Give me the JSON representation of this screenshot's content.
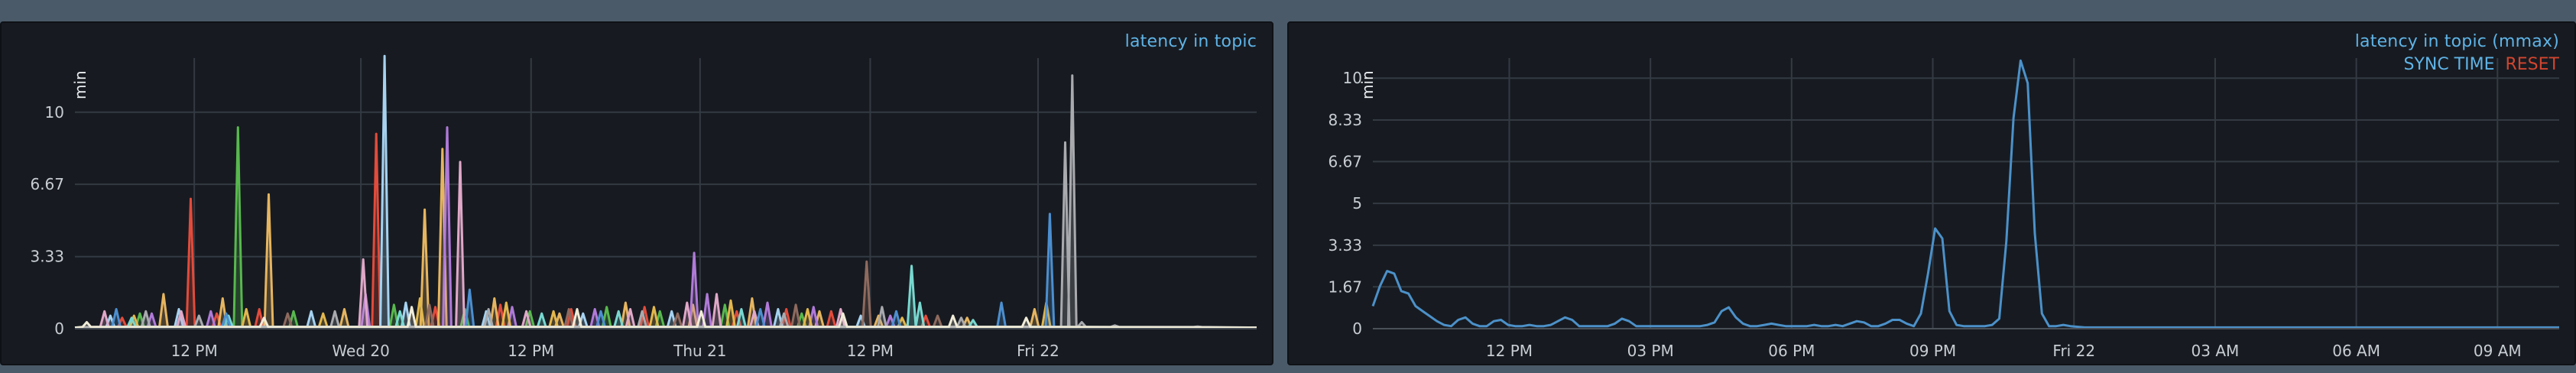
{
  "panels": [
    {
      "title": "latency in topic",
      "unit": "min",
      "sync_label": "",
      "reset_label": ""
    },
    {
      "title": "latency in topic (mmax)",
      "unit": "min",
      "sync_label": "SYNC TIME",
      "reset_label": "RESET"
    }
  ],
  "colors": {
    "page_bg": "#4b5a68",
    "panel_bg": "#171b21",
    "grid": "#343a42",
    "title": "#5fb3e6",
    "reset": "#d2452f",
    "line": "#4c91c9"
  },
  "chart_data": [
    {
      "type": "line",
      "title": "latency in topic",
      "ylabel": "min",
      "xlabel": "",
      "ylim": [
        0,
        12.5
      ],
      "xlim": [
        0,
        100
      ],
      "x_ticks": [
        {
          "x": 10.1,
          "label": "12 PM"
        },
        {
          "x": 24.2,
          "label": "Wed 20"
        },
        {
          "x": 38.6,
          "label": "12 PM"
        },
        {
          "x": 52.9,
          "label": "Thu 21"
        },
        {
          "x": 67.3,
          "label": "12 PM"
        },
        {
          "x": 81.5,
          "label": "Fri 22"
        }
      ],
      "y_ticks": [
        0,
        3.33,
        6.67,
        10
      ],
      "grid": true,
      "legend": "none",
      "series": [
        {
          "color": "#e24b3b",
          "peaks": [
            [
              4,
              0.5
            ],
            [
              9.8,
              6
            ],
            [
              12,
              0.7
            ],
            [
              15.6,
              0.9
            ],
            [
              25.5,
              9
            ],
            [
              30.5,
              1.0
            ],
            [
              36,
              1.1
            ],
            [
              42,
              0.9
            ],
            [
              48.2,
              1.0
            ],
            [
              56,
              0.8
            ],
            [
              60.2,
              0.9
            ],
            [
              64,
              0.8
            ],
            [
              72,
              0.6
            ]
          ]
        },
        {
          "color": "#e6b560",
          "peaks": [
            [
              7.5,
              1.6
            ],
            [
              12.5,
              1.4
            ],
            [
              16.4,
              6.2
            ],
            [
              22.8,
              0.9
            ],
            [
              29.6,
              5.5
            ],
            [
              31.1,
              8.3
            ],
            [
              35.5,
              1.4
            ],
            [
              41,
              0.7
            ],
            [
              46.6,
              1.2
            ],
            [
              52.3,
              1.1
            ],
            [
              57.3,
              1.4
            ],
            [
              63,
              0.8
            ],
            [
              68,
              0.6
            ],
            [
              75.5,
              0.5
            ],
            [
              81.2,
              0.9
            ]
          ]
        },
        {
          "color": "#58b84e",
          "peaks": [
            [
              5.5,
              0.7
            ],
            [
              13.8,
              9.3
            ],
            [
              18.5,
              0.8
            ],
            [
              27,
              1.1
            ],
            [
              33,
              0.9
            ],
            [
              38.5,
              0.8
            ],
            [
              45,
              1.0
            ],
            [
              49.5,
              0.8
            ],
            [
              55,
              1.1
            ],
            [
              61.5,
              0.7
            ]
          ]
        },
        {
          "color": "#a6d2f0",
          "peaks": [
            [
              3,
              0.6
            ],
            [
              8.8,
              0.9
            ],
            [
              20,
              0.8
            ],
            [
              26.2,
              12.6
            ],
            [
              28,
              1.2
            ],
            [
              34.8,
              0.8
            ],
            [
              43,
              0.7
            ],
            [
              50.5,
              0.8
            ],
            [
              59.5,
              0.9
            ],
            [
              66.5,
              0.6
            ]
          ]
        },
        {
          "color": "#b07ad8",
          "peaks": [
            [
              6.5,
              0.7
            ],
            [
              11.5,
              0.8
            ],
            [
              24.6,
              1.6
            ],
            [
              31.5,
              9.3
            ],
            [
              37,
              1.0
            ],
            [
              44,
              0.9
            ],
            [
              52.4,
              3.5
            ],
            [
              53.5,
              1.6
            ],
            [
              58.6,
              1.2
            ],
            [
              62.5,
              1.0
            ],
            [
              69,
              0.6
            ]
          ]
        },
        {
          "color": "#e0a8c8",
          "peaks": [
            [
              2.5,
              0.8
            ],
            [
              9,
              0.8
            ],
            [
              24.4,
              3.2
            ],
            [
              32.6,
              7.7
            ],
            [
              38.2,
              0.8
            ],
            [
              47,
              0.9
            ],
            [
              51.8,
              1.2
            ],
            [
              54.3,
              1.6
            ],
            [
              57.5,
              0.8
            ],
            [
              64.8,
              0.9
            ]
          ]
        },
        {
          "color": "#e2b74d",
          "peaks": [
            [
              5,
              0.6
            ],
            [
              14.5,
              0.9
            ],
            [
              21,
              0.7
            ],
            [
              29.2,
              1.4
            ],
            [
              36.5,
              1.2
            ],
            [
              40.5,
              0.8
            ],
            [
              49,
              1.0
            ],
            [
              55.5,
              1.3
            ],
            [
              62,
              0.9
            ],
            [
              70,
              0.5
            ],
            [
              82.2,
              1.2
            ]
          ]
        },
        {
          "color": "#78d8d0",
          "peaks": [
            [
              4.8,
              0.5
            ],
            [
              13,
              0.6
            ],
            [
              27.5,
              0.8
            ],
            [
              39.5,
              0.7
            ],
            [
              46,
              0.8
            ],
            [
              56.4,
              0.9
            ],
            [
              70.8,
              2.9
            ],
            [
              71.5,
              1.2
            ],
            [
              76,
              0.4
            ]
          ]
        },
        {
          "color": "#8e6a5e",
          "peaks": [
            [
              18,
              0.7
            ],
            [
              30,
              1.1
            ],
            [
              41.8,
              0.9
            ],
            [
              51,
              0.7
            ],
            [
              61,
              1.1
            ],
            [
              67,
              3.1
            ],
            [
              73,
              0.6
            ]
          ]
        },
        {
          "color": "#4c8fd0",
          "peaks": [
            [
              3.5,
              0.9
            ],
            [
              12.8,
              0.7
            ],
            [
              33.4,
              1.8
            ],
            [
              44.5,
              0.8
            ],
            [
              58,
              0.9
            ],
            [
              69.5,
              0.8
            ],
            [
              78.4,
              1.2
            ],
            [
              82.5,
              5.3
            ]
          ]
        },
        {
          "color": "#a8aaae",
          "peaks": [
            [
              6,
              0.8
            ],
            [
              10.5,
              0.6
            ],
            [
              22,
              0.8
            ],
            [
              35,
              0.9
            ],
            [
              48,
              0.8
            ],
            [
              60,
              0.7
            ],
            [
              68.3,
              1.0
            ],
            [
              75,
              0.5
            ],
            [
              83.8,
              8.6
            ],
            [
              84.4,
              11.7
            ],
            [
              85.2,
              0.3
            ],
            [
              88,
              0.15
            ],
            [
              95,
              0.1
            ]
          ]
        },
        {
          "color": "#f0ecd8",
          "peaks": [
            [
              1,
              0.3
            ],
            [
              16,
              0.5
            ],
            [
              28.5,
              1.0
            ],
            [
              42.5,
              0.9
            ],
            [
              53,
              0.8
            ],
            [
              65,
              0.7
            ],
            [
              74.3,
              0.6
            ],
            [
              80.5,
              0.5
            ]
          ]
        }
      ]
    },
    {
      "type": "line",
      "title": "latency in topic (mmax)",
      "ylabel": "min",
      "xlabel": "",
      "ylim": [
        0,
        10.8
      ],
      "xlim": [
        0,
        100
      ],
      "x_ticks": [
        {
          "x": 11.5,
          "label": "12 PM"
        },
        {
          "x": 23.4,
          "label": "03 PM"
        },
        {
          "x": 35.3,
          "label": "06 PM"
        },
        {
          "x": 47.2,
          "label": "09 PM"
        },
        {
          "x": 59.1,
          "label": "Fri 22"
        },
        {
          "x": 71.0,
          "label": "03 AM"
        },
        {
          "x": 82.9,
          "label": "06 AM"
        },
        {
          "x": 94.8,
          "label": "09 AM"
        }
      ],
      "y_ticks": [
        0,
        1.67,
        3.33,
        5,
        6.67,
        8.33,
        10
      ],
      "grid": true,
      "legend": "none",
      "series": [
        {
          "color": "#4c91c9",
          "x": [
            0,
            0.6,
            1.2,
            1.8,
            2.4,
            3.0,
            3.6,
            4.2,
            4.8,
            5.4,
            6.0,
            6.6,
            7.2,
            7.8,
            8.4,
            9.0,
            9.6,
            10.2,
            10.8,
            11.4,
            12.0,
            12.6,
            13.2,
            13.8,
            14.4,
            15.0,
            15.6,
            16.2,
            16.8,
            17.4,
            18.0,
            18.6,
            19.2,
            19.8,
            20.4,
            21.0,
            21.6,
            22.2,
            22.8,
            23.4,
            24.0,
            24.6,
            25.2,
            25.8,
            26.4,
            27.0,
            27.6,
            28.2,
            28.8,
            29.4,
            30.0,
            30.6,
            31.2,
            31.8,
            32.4,
            33.0,
            33.6,
            34.2,
            34.8,
            35.4,
            36.0,
            36.6,
            37.2,
            37.8,
            38.4,
            39.0,
            39.6,
            40.2,
            40.8,
            41.4,
            42.0,
            42.6,
            43.2,
            43.8,
            44.4,
            45.0,
            45.6,
            46.2,
            46.8,
            47.4,
            48.0,
            48.6,
            49.2,
            49.8,
            50.4,
            51.0,
            51.6,
            52.2,
            52.8,
            53.4,
            54.0,
            54.6,
            55.2,
            55.8,
            56.4,
            57.0,
            57.6,
            58.2,
            58.8,
            60,
            65,
            70,
            75,
            80,
            85,
            90,
            95,
            100
          ],
          "values": [
            0.9,
            1.7,
            2.3,
            2.2,
            1.5,
            1.4,
            0.9,
            0.7,
            0.5,
            0.3,
            0.15,
            0.1,
            0.35,
            0.45,
            0.2,
            0.1,
            0.1,
            0.3,
            0.35,
            0.15,
            0.1,
            0.1,
            0.15,
            0.1,
            0.1,
            0.15,
            0.3,
            0.45,
            0.35,
            0.1,
            0.1,
            0.1,
            0.1,
            0.1,
            0.2,
            0.4,
            0.3,
            0.1,
            0.1,
            0.1,
            0.1,
            0.1,
            0.1,
            0.1,
            0.1,
            0.1,
            0.1,
            0.15,
            0.25,
            0.7,
            0.85,
            0.45,
            0.2,
            0.1,
            0.1,
            0.15,
            0.2,
            0.15,
            0.1,
            0.1,
            0.1,
            0.1,
            0.15,
            0.1,
            0.1,
            0.15,
            0.1,
            0.2,
            0.3,
            0.25,
            0.1,
            0.1,
            0.2,
            0.35,
            0.35,
            0.2,
            0.1,
            0.6,
            2.2,
            4.0,
            3.6,
            0.7,
            0.15,
            0.1,
            0.1,
            0.1,
            0.1,
            0.15,
            0.4,
            3.5,
            8.4,
            10.7,
            9.8,
            3.8,
            0.6,
            0.1,
            0.1,
            0.15,
            0.1,
            0.05,
            0.05,
            0.05,
            0.05,
            0.05,
            0.05,
            0.05,
            0.05,
            0.05
          ]
        }
      ]
    }
  ]
}
